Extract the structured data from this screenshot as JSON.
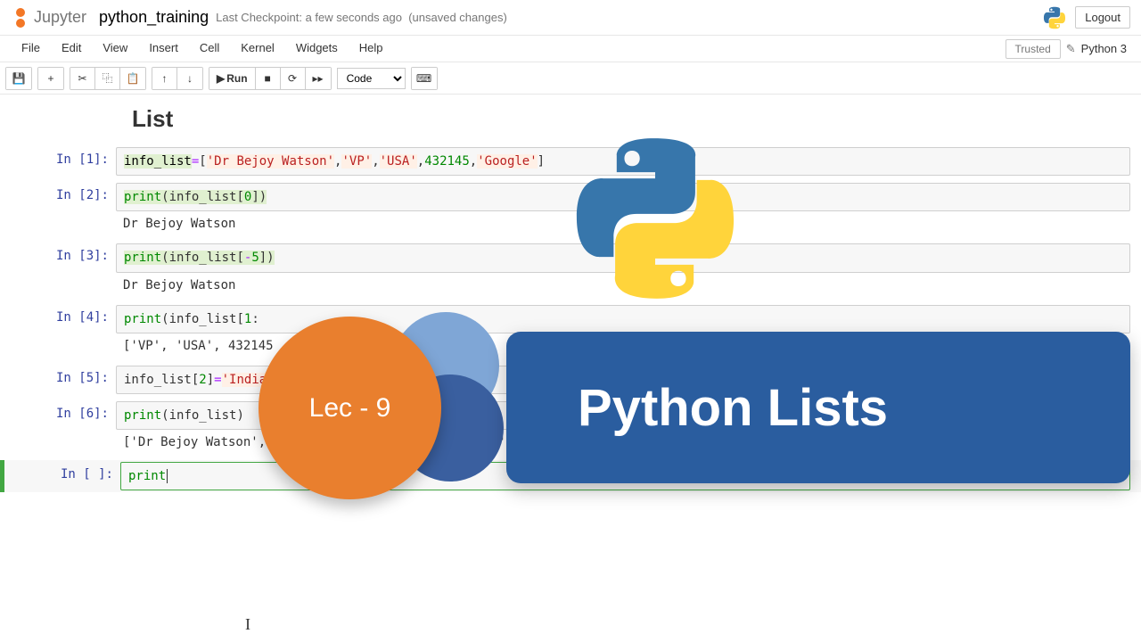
{
  "header": {
    "logo_text": "Jupyter",
    "notebook_name": "python_training",
    "checkpoint": "Last Checkpoint: a few seconds ago",
    "unsaved": "(unsaved changes)",
    "logout": "Logout"
  },
  "menubar": {
    "items": [
      "File",
      "Edit",
      "View",
      "Insert",
      "Cell",
      "Kernel",
      "Widgets",
      "Help"
    ],
    "trusted": "Trusted",
    "kernel": "Python 3"
  },
  "toolbar": {
    "run_label": "Run",
    "cell_type": "Code"
  },
  "cells": {
    "heading": "List",
    "c1": {
      "prompt": "In [1]:",
      "code_var": "info_list",
      "code_rest": "=['Dr Bejoy Watson','VP','USA',432145,'Google']"
    },
    "c2": {
      "prompt": "In [2]:",
      "code": "print(info_list[0])",
      "out": "Dr Bejoy Watson"
    },
    "c3": {
      "prompt": "In [3]:",
      "code": "print(info_list[-5])",
      "out": "Dr Bejoy Watson"
    },
    "c4": {
      "prompt": "In [4]:",
      "code": "print(info_list[1:",
      "out": "['VP', 'USA', 432145"
    },
    "c5": {
      "prompt": "In [5]:",
      "code": "info_list[2]='India'"
    },
    "c6": {
      "prompt": "In [6]:",
      "code": "print(info_list)",
      "out": "['Dr Bejoy Watson', 'VP', 'India', 432145, 'Google']"
    },
    "c7": {
      "prompt": "In [ ]:",
      "code": "print"
    }
  },
  "overlay": {
    "lec": "Lec - 9",
    "title": "Python Lists"
  }
}
